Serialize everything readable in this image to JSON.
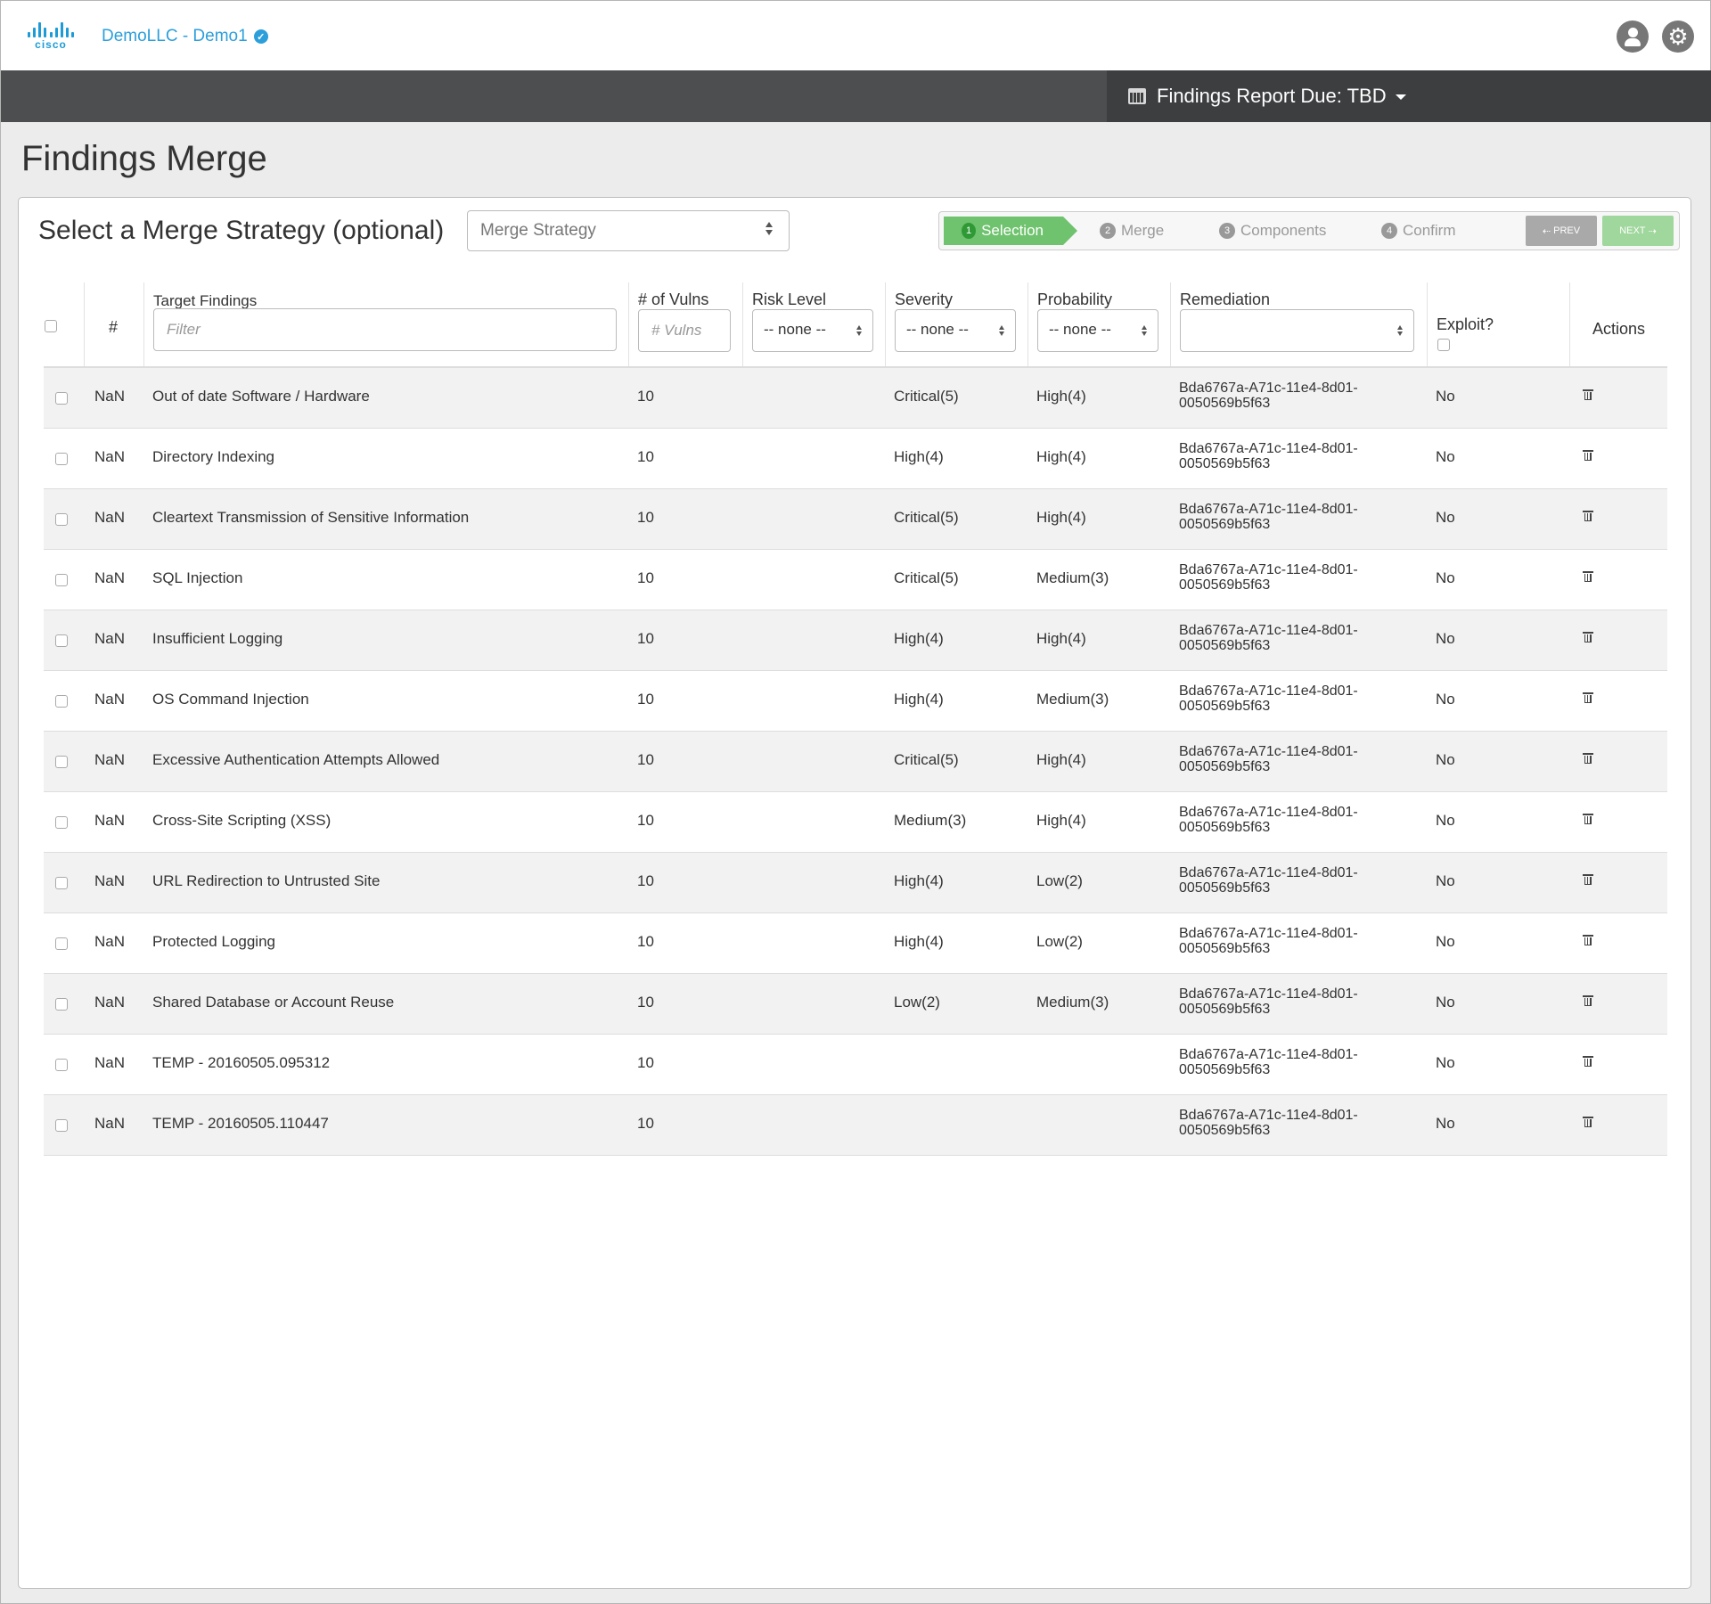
{
  "header": {
    "logo_text": "cisco",
    "org_name": "DemoLLC - Demo1",
    "user_icon": "user-icon",
    "settings_icon": "gear-icon",
    "report_due": "Findings Report Due: TBD"
  },
  "page": {
    "title": "Findings Merge",
    "strategy_label": "Select a Merge Strategy (optional)",
    "strategy_select": {
      "placeholder": "Merge Strategy"
    }
  },
  "wizard": {
    "steps": [
      {
        "num": "1",
        "label": "Selection",
        "active": true
      },
      {
        "num": "2",
        "label": "Merge",
        "active": false
      },
      {
        "num": "3",
        "label": "Components",
        "active": false
      },
      {
        "num": "4",
        "label": "Confirm",
        "active": false
      }
    ],
    "prev_label": "PREV",
    "next_label": "NEXT",
    "accent_color": "#6fc26e"
  },
  "table": {
    "headers": {
      "num": "#",
      "target": "Target Findings",
      "target_filter_placeholder": "Filter",
      "vulns": "# of Vulns",
      "vulns_placeholder": "# Vulns",
      "risk": "Risk Level",
      "risk_value": "-- none --",
      "severity": "Severity",
      "severity_value": "-- none --",
      "probability": "Probability",
      "probability_value": "-- none --",
      "remediation": "Remediation",
      "remediation_value": "",
      "exploit": "Exploit?",
      "actions": "Actions"
    },
    "rows": [
      {
        "num": "NaN",
        "target": "Out of date Software / Hardware",
        "vulns": "10",
        "risk": "",
        "severity": "Critical(5)",
        "probability": "High(4)",
        "rem1": "Bda6767a-A71c-11e4-8d01-",
        "rem2": "0050569b5f63",
        "exploit": "No"
      },
      {
        "num": "NaN",
        "target": "Directory Indexing",
        "vulns": "10",
        "risk": "",
        "severity": "High(4)",
        "probability": "High(4)",
        "rem1": "Bda6767a-A71c-11e4-8d01-",
        "rem2": "0050569b5f63",
        "exploit": "No"
      },
      {
        "num": "NaN",
        "target": "Cleartext Transmission of Sensitive Information",
        "vulns": "10",
        "risk": "",
        "severity": "Critical(5)",
        "probability": "High(4)",
        "rem1": "Bda6767a-A71c-11e4-8d01-",
        "rem2": "0050569b5f63",
        "exploit": "No"
      },
      {
        "num": "NaN",
        "target": "SQL Injection",
        "vulns": "10",
        "risk": "",
        "severity": "Critical(5)",
        "probability": "Medium(3)",
        "rem1": "Bda6767a-A71c-11e4-8d01-",
        "rem2": "0050569b5f63",
        "exploit": "No"
      },
      {
        "num": "NaN",
        "target": "Insufficient Logging",
        "vulns": "10",
        "risk": "",
        "severity": "High(4)",
        "probability": "High(4)",
        "rem1": "Bda6767a-A71c-11e4-8d01-",
        "rem2": "0050569b5f63",
        "exploit": "No"
      },
      {
        "num": "NaN",
        "target": "OS Command Injection",
        "vulns": "10",
        "risk": "",
        "severity": "High(4)",
        "probability": "Medium(3)",
        "rem1": "Bda6767a-A71c-11e4-8d01-",
        "rem2": "0050569b5f63",
        "exploit": "No"
      },
      {
        "num": "NaN",
        "target": "Excessive Authentication Attempts Allowed",
        "vulns": "10",
        "risk": "",
        "severity": "Critical(5)",
        "probability": "High(4)",
        "rem1": "Bda6767a-A71c-11e4-8d01-",
        "rem2": "0050569b5f63",
        "exploit": "No"
      },
      {
        "num": "NaN",
        "target": "Cross-Site Scripting (XSS)",
        "vulns": "10",
        "risk": "",
        "severity": "Medium(3)",
        "probability": "High(4)",
        "rem1": "Bda6767a-A71c-11e4-8d01-",
        "rem2": "0050569b5f63",
        "exploit": "No"
      },
      {
        "num": "NaN",
        "target": "URL Redirection to Untrusted Site",
        "vulns": "10",
        "risk": "",
        "severity": "High(4)",
        "probability": "Low(2)",
        "rem1": "Bda6767a-A71c-11e4-8d01-",
        "rem2": "0050569b5f63",
        "exploit": "No"
      },
      {
        "num": "NaN",
        "target": "Protected Logging",
        "vulns": "10",
        "risk": "",
        "severity": "High(4)",
        "probability": "Low(2)",
        "rem1": "Bda6767a-A71c-11e4-8d01-",
        "rem2": "0050569b5f63",
        "exploit": "No"
      },
      {
        "num": "NaN",
        "target": "Shared Database or Account Reuse",
        "vulns": "10",
        "risk": "",
        "severity": "Low(2)",
        "probability": "Medium(3)",
        "rem1": "Bda6767a-A71c-11e4-8d01-",
        "rem2": "0050569b5f63",
        "exploit": "No"
      },
      {
        "num": "NaN",
        "target": "TEMP - 20160505.095312",
        "vulns": "10",
        "risk": "",
        "severity": "",
        "probability": "",
        "rem1": "Bda6767a-A71c-11e4-8d01-",
        "rem2": "0050569b5f63",
        "exploit": "No"
      },
      {
        "num": "NaN",
        "target": "TEMP - 20160505.110447",
        "vulns": "10",
        "risk": "",
        "severity": "",
        "probability": "",
        "rem1": "Bda6767a-A71c-11e4-8d01-",
        "rem2": "0050569b5f63",
        "exploit": "No"
      }
    ],
    "row_action_icon": "trash-icon"
  }
}
